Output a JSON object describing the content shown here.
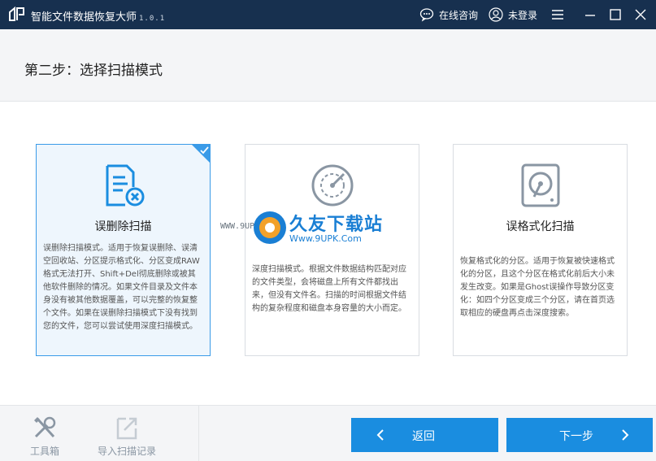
{
  "window": {
    "title": "智能文件数据恢复大师",
    "version": "1.0.1",
    "consult_label": "在线咨询",
    "login_label": "未登录",
    "icons": [
      "logo-icon",
      "chat-icon",
      "user-icon",
      "menu-icon",
      "minimize-icon",
      "maximize-icon",
      "close-icon"
    ]
  },
  "step": {
    "title": "第二步：选择扫描模式"
  },
  "cards": [
    {
      "title": "误删除扫描",
      "icon": "document-delete-icon",
      "selected": true,
      "description": "误删除扫描模式。适用于恢复误删除、误清空回收站、分区提示格式化、分区变成RAW格式无法打开、Shift+Del彻底删除或被其他软件删除的情况。如果文件目录及文件本身没有被其他数据覆盖，可以完整的恢复整个文件。如果在误删除扫描模式下没有找到您的文件，您可以尝试使用深度扫描模式。"
    },
    {
      "title": "",
      "icon": "radar-icon",
      "selected": false,
      "description": "深度扫描模式。根据文件数据结构匹配对应的文件类型，会将磁盘上所有文件都找出来，但没有文件名。扫描的时间根据文件结构的复杂程度和磁盘本身容量的大小而定。"
    },
    {
      "title": "误格式化扫描",
      "icon": "disk-icon",
      "selected": false,
      "description": "恢复格式化的分区。适用于恢复被快速格式化的分区，且这个分区在格式化前后大小未发生改变。如果是Ghost误操作导致分区变化：如四个分区变成三个分区，请在首页选取相应的硬盘再点击深度搜索。"
    }
  ],
  "watermark": {
    "url_left": "WWW.9UPK.COM",
    "main": "久友下载站",
    "sub": "Www.9UPK.Com"
  },
  "bottom": {
    "toolbox_label": "工具箱",
    "import_label": "导入扫描记录",
    "back_label": "返回",
    "next_label": "下一步"
  },
  "colors": {
    "titlebar": "#17304f",
    "accent": "#1a8de0",
    "selected_border": "#3a9be8",
    "selected_bg": "#eef6fd"
  }
}
